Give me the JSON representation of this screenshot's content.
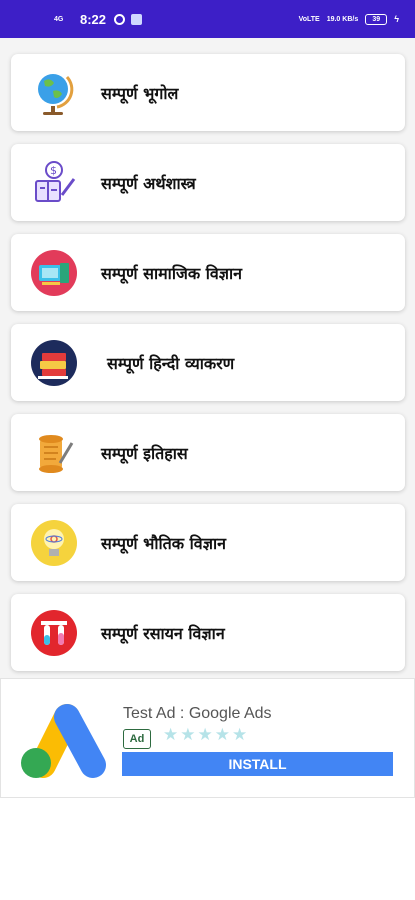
{
  "status_bar": {
    "network": "4G",
    "time": "8:22",
    "right_net": "VoLTE",
    "speed": "19.0 KB/s",
    "battery": "39"
  },
  "subjects": [
    {
      "label": "सम्पूर्ण भूगोल",
      "icon": "globe-icon"
    },
    {
      "label": "सम्पूर्ण अर्थशास्त्र",
      "icon": "economics-icon"
    },
    {
      "label": "सम्पूर्ण सामाजिक विज्ञान",
      "icon": "social-science-icon"
    },
    {
      "label": "सम्पूर्ण हिन्दी व्याकरण",
      "icon": "books-icon"
    },
    {
      "label": "सम्पूर्ण इतिहास",
      "icon": "scroll-icon"
    },
    {
      "label": "सम्पूर्ण भौतिक विज्ञान",
      "icon": "bulb-icon"
    },
    {
      "label": "सम्पूर्ण रसायन विज्ञान",
      "icon": "test-tubes-icon"
    }
  ],
  "ad": {
    "title": "Test Ad : Google Ads",
    "badge": "Ad",
    "stars": "★★★★★",
    "rating": 4.5,
    "install_label": "INSTALL"
  },
  "colors": {
    "status_bar": "#3d1fc7",
    "install": "#4285f4"
  }
}
